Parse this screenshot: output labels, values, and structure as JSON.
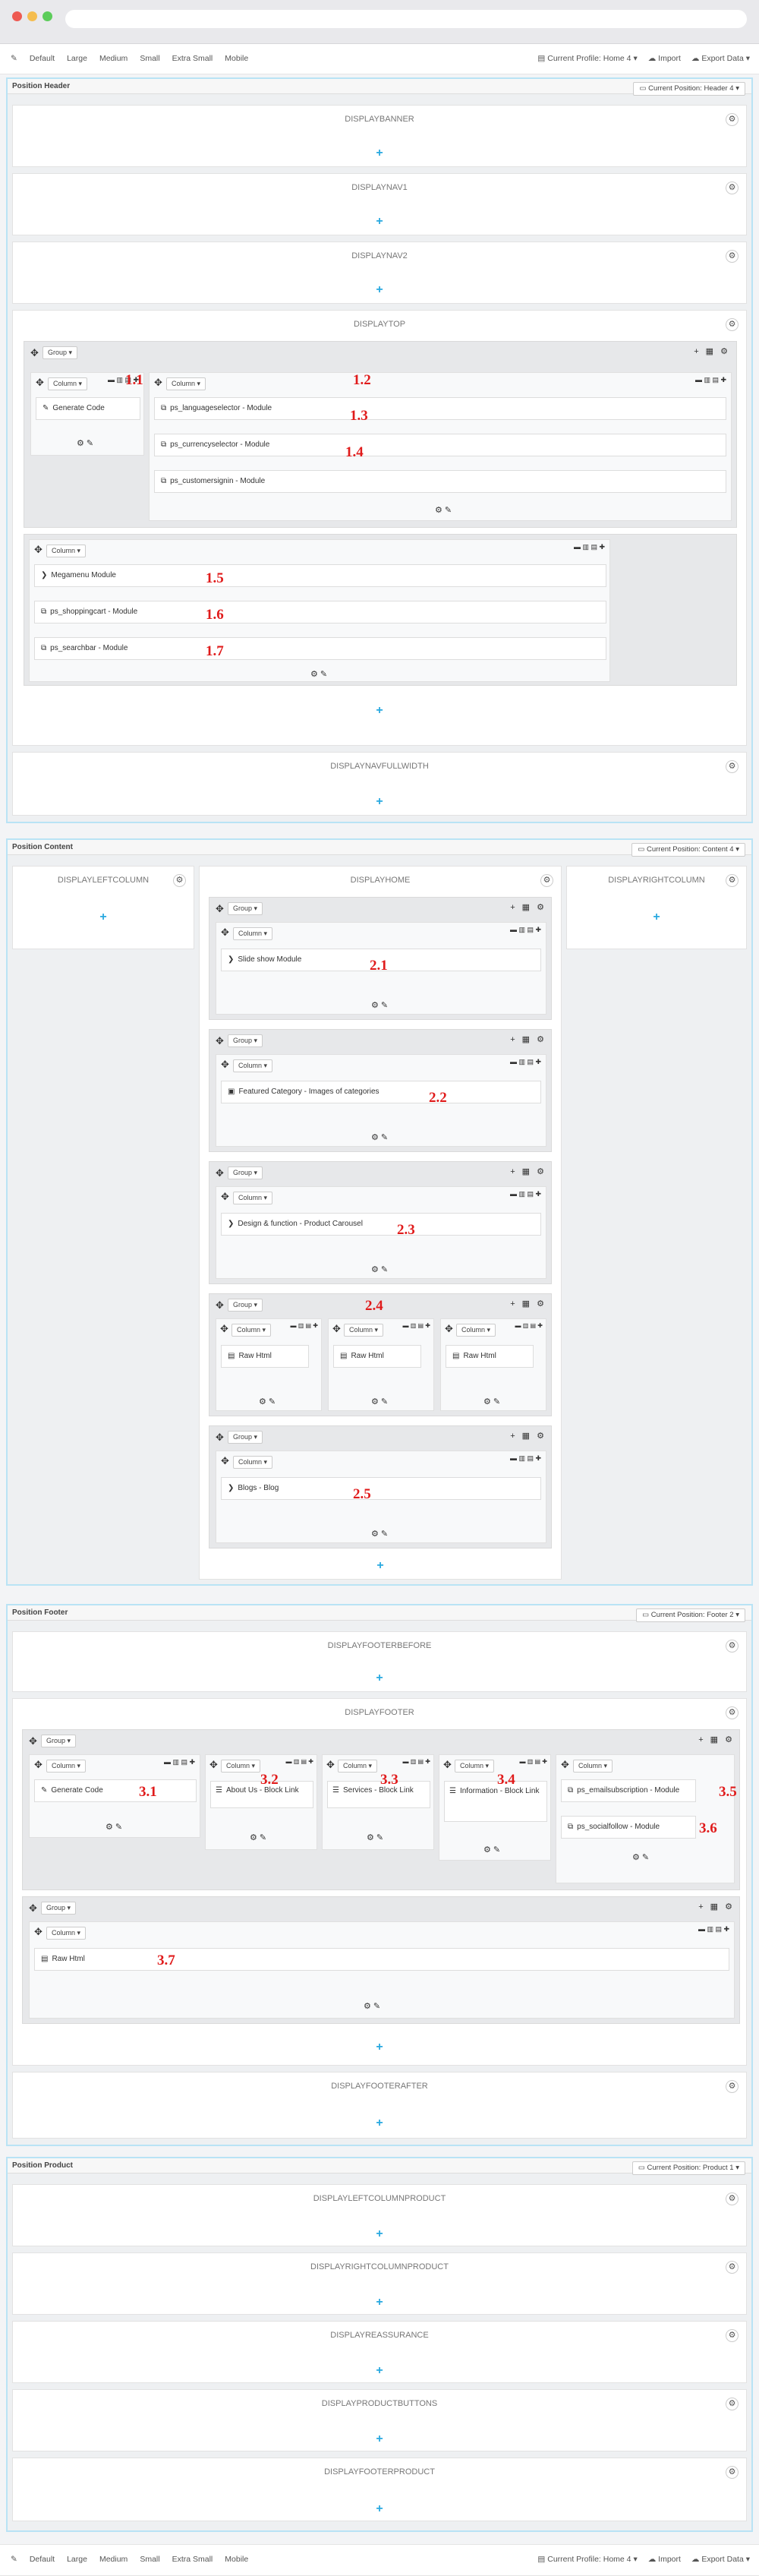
{
  "toolbar": {
    "devices": [
      "Default",
      "Large",
      "Medium",
      "Small",
      "Extra Small",
      "Mobile"
    ],
    "profile": "Current Profile: Home 4",
    "import": "Import",
    "export": "Export Data"
  },
  "sections": {
    "header": {
      "title": "Position Header",
      "position": "Current Position: Header 4"
    },
    "content": {
      "title": "Position Content",
      "position": "Current Position: Content 4"
    },
    "footer": {
      "title": "Position Footer",
      "position": "Current Position: Footer 2"
    },
    "product": {
      "title": "Position Product",
      "position": "Current Position: Product 1"
    }
  },
  "hooks": {
    "displaybanner": "DISPLAYBANNER",
    "displaynav1": "DISPLAYNAV1",
    "displaynav2": "DISPLAYNAV2",
    "displaytop": "DISPLAYTOP",
    "displaynavfullwidth": "DISPLAYNAVFULLWIDTH",
    "displayleftcolumn": "DISPLAYLEFTCOLUMN",
    "displayhome": "DISPLAYHOME",
    "displayrightcolumn": "DISPLAYRIGHTCOLUMN",
    "displayfooterbefore": "DISPLAYFOOTERBEFORE",
    "displayfooter": "DISPLAYFOOTER",
    "displayfooterafter": "DISPLAYFOOTERAFTER",
    "displayleftcolumnproduct": "DISPLAYLEFTCOLUMNPRODUCT",
    "displayrightcolumnproduct": "DISPLAYRIGHTCOLUMNPRODUCT",
    "displayreassurance": "DISPLAYREASSURANCE",
    "displayproductbuttons": "DISPLAYPRODUCTBUTTONS",
    "displayfooterproduct": "DISPLAYFOOTERPRODUCT"
  },
  "labels": {
    "group": "Group",
    "column": "Column"
  },
  "modules": {
    "m1_1": "Generate Code",
    "m1_2": "ps_languageselector - Module",
    "m1_3": "ps_currencyselector - Module",
    "m1_4": "ps_customersignin - Module",
    "m1_5": "Megamenu Module",
    "m1_6": "ps_shoppingcart - Module",
    "m1_7": "ps_searchbar - Module",
    "m2_1": "Slide show Module",
    "m2_2": "Featured Category - Images of categories",
    "m2_3": "Design & function - Product Carousel",
    "m2_4a": "Raw Html",
    "m2_4b": "Raw Html",
    "m2_4c": "Raw Html",
    "m2_5": "Blogs - Blog",
    "m3_1": "Generate Code",
    "m3_2": "About Us - Block Link",
    "m3_3": "Services - Block Link",
    "m3_4": "Information - Block Link",
    "m3_5": "ps_emailsubscription - Module",
    "m3_6": "ps_socialfollow - Module",
    "m3_7": "Raw Html"
  },
  "numbers": {
    "n1_1": "1.1",
    "n1_2": "1.2",
    "n1_3": "1.3",
    "n1_4": "1.4",
    "n1_5": "1.5",
    "n1_6": "1.6",
    "n1_7": "1.7",
    "n2_1": "2.1",
    "n2_2": "2.2",
    "n2_3": "2.3",
    "n2_4": "2.4",
    "n2_5": "2.5",
    "n3_1": "3.1",
    "n3_2": "3.2",
    "n3_3": "3.3",
    "n3_4": "3.4",
    "n3_5": "3.5",
    "n3_6": "3.6",
    "n3_7": "3.7"
  },
  "icons": {
    "gear": "⚙",
    "plus": "+",
    "move": "✥",
    "edit": "⚙ ✎",
    "group_tools": "+ ▦ ⚙",
    "col_tools": "▬ ▥ ▤ ✚",
    "dropdown": "▾",
    "module": "⧉",
    "code": "✎",
    "chevron": "❯",
    "list": "☰",
    "html": "▤",
    "image": "▣",
    "monitor": "▭",
    "download": "⤓"
  },
  "colors": {
    "accent": "#29a9e0",
    "section_border": "#b9e3f5",
    "number_red": "#e01b1b"
  }
}
